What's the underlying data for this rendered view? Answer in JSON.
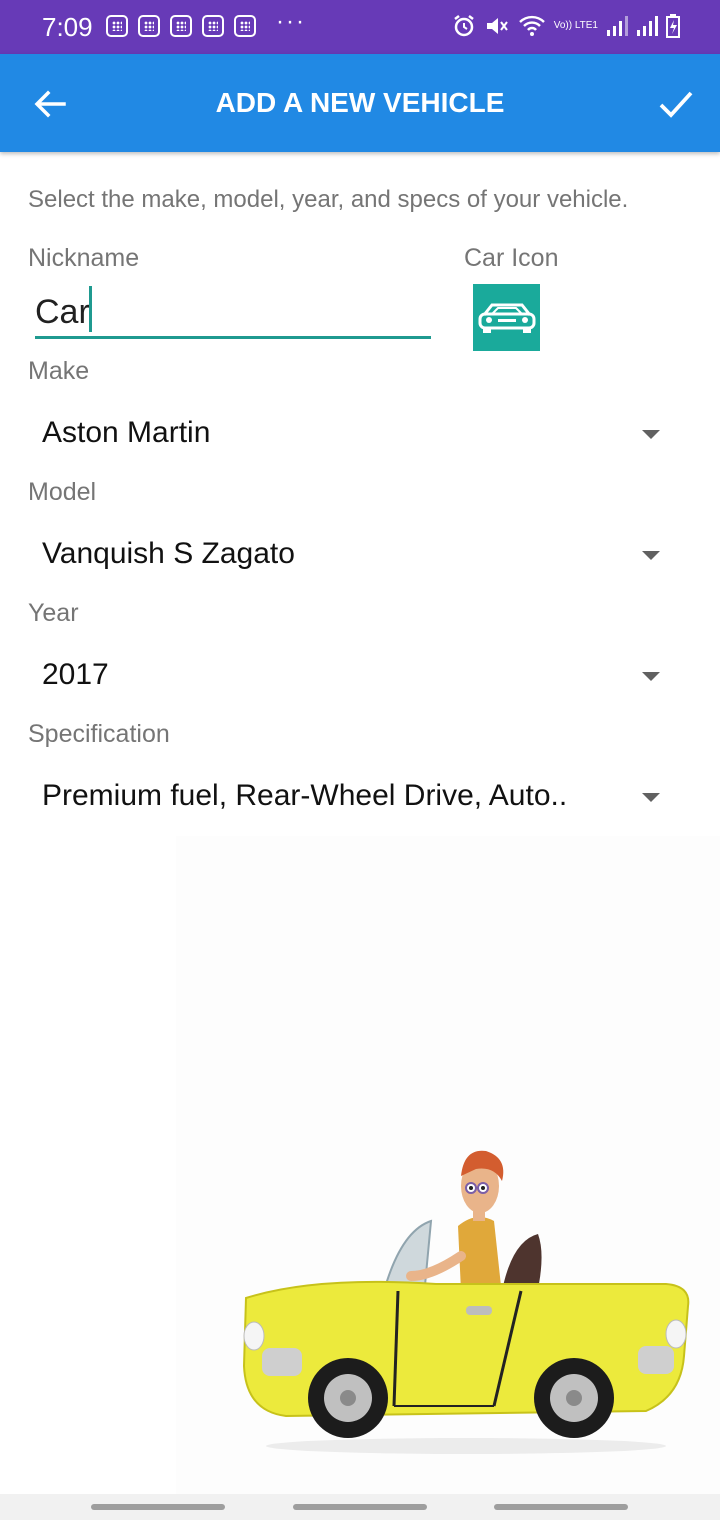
{
  "status_bar": {
    "time": "7:09",
    "more": "···",
    "network_label": "Vo)) LTE1"
  },
  "toolbar": {
    "title": "ADD A NEW VEHICLE",
    "back_icon": "arrow-left-icon",
    "done_icon": "checkmark-icon"
  },
  "form": {
    "instructions": "Select the make, model, year, and specs of your vehicle.",
    "nickname": {
      "label": "Nickname",
      "value": "Car"
    },
    "car_icon": {
      "label": "Car Icon",
      "icon": "car-icon",
      "color": "#1aaa9b"
    },
    "make": {
      "label": "Make",
      "value": "Aston Martin"
    },
    "model": {
      "label": "Model",
      "value": "Vanquish S Zagato"
    },
    "year": {
      "label": "Year",
      "value": "2017"
    },
    "specification": {
      "label": "Specification",
      "value": "Premium fuel, Rear-Wheel Drive, Auto.."
    }
  },
  "colors": {
    "status_bar": "#673ab7",
    "toolbar": "#2189e4",
    "accent": "#1f9a90"
  }
}
